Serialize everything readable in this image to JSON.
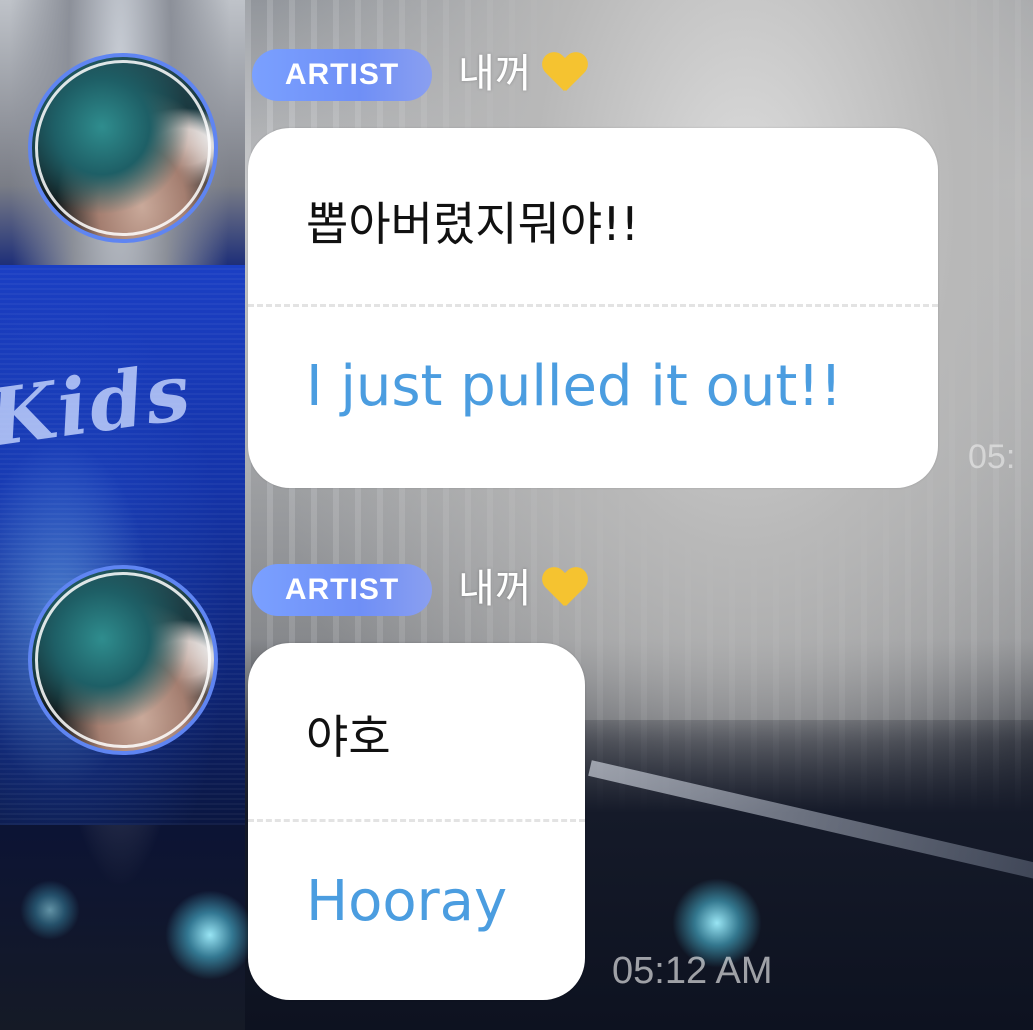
{
  "messages": [
    {
      "badge": "ARTIST",
      "sender": "내꺼",
      "sender_icon": "yellow-heart-icon",
      "original_text": "뽑아버렸지뭐야!!",
      "translated_text": "I just pulled it out!!"
    },
    {
      "badge": "ARTIST",
      "sender": "내꺼",
      "sender_icon": "yellow-heart-icon",
      "original_text": "야호",
      "translated_text": "Hooray",
      "timestamp": "05:12 AM"
    }
  ],
  "background": {
    "banner_text": "Kids",
    "ghost_timestamp": "05:"
  },
  "colors": {
    "badge": "#6f8ff6",
    "translation_text": "#4b9de0",
    "heart": "#f5c330",
    "bubble": "#ffffff"
  }
}
